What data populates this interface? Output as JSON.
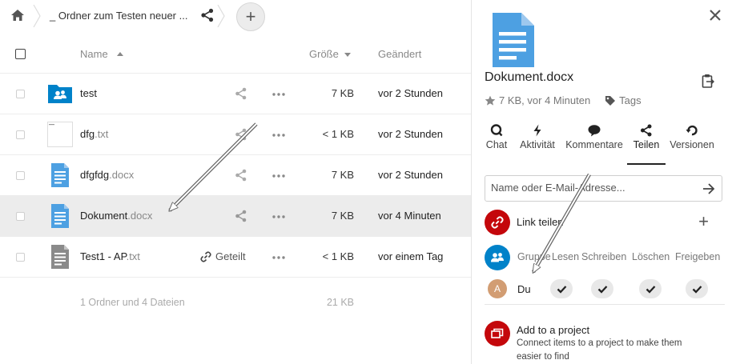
{
  "breadcrumb": {
    "folder": "_ Ordner zum Testen neuer ...",
    "add_label": "+"
  },
  "table": {
    "col_name": "Name",
    "col_size": "Größe",
    "col_modified": "Geändert"
  },
  "files": [
    {
      "name": "test",
      "ext": "",
      "type": "shared-folder",
      "size": "7 KB",
      "modified": "vor 2 Stunden",
      "shared": false
    },
    {
      "name": "dfg",
      "ext": ".txt",
      "type": "text-thumb",
      "size": "< 1 KB",
      "modified": "vor 2 Stunden",
      "shared": false
    },
    {
      "name": "dfgfdg",
      "ext": ".docx",
      "type": "docx",
      "size": "7 KB",
      "modified": "vor 2 Stunden",
      "shared": false
    },
    {
      "name": "Dokument",
      "ext": ".docx",
      "type": "docx",
      "size": "7 KB",
      "modified": "vor 4 Minuten",
      "shared": false
    },
    {
      "name": "Test1 - AP",
      "ext": ".txt",
      "type": "txt",
      "size": "< 1 KB",
      "modified": "vor einem Tag",
      "shared": true,
      "shared_label": "Geteilt"
    }
  ],
  "summary": {
    "count": "1 Ordner und 4 Dateien",
    "total": "21 KB"
  },
  "sidebar": {
    "title": "Dokument.docx",
    "meta_size": "7 KB, vor 4 Minuten",
    "meta_tags": "Tags",
    "tabs": [
      {
        "label": "Chat",
        "icon": "chat-icon"
      },
      {
        "label": "Aktivität",
        "icon": "activity-icon"
      },
      {
        "label": "Kommentare",
        "icon": "comment-icon"
      },
      {
        "label": "Teilen",
        "icon": "share-icon",
        "active": true
      },
      {
        "label": "Versionen",
        "icon": "history-icon"
      }
    ],
    "share_placeholder": "Name oder E-Mail-Adresse...",
    "link_label": "Link teilen",
    "perm_headers": [
      "Gruppe",
      "Lesen",
      "Schreiben",
      "Löschen",
      "Freigeben"
    ],
    "perm_user": {
      "initial": "A",
      "name": "Du"
    },
    "project_title": "Add to a project",
    "project_desc": "Connect items to a project to make them easier to find"
  },
  "colors": {
    "accent_blue": "#0082c9",
    "doc_blue": "#4da0e2",
    "link_red": "#c4070b",
    "text_gray": "#888888",
    "avatar_tan": "#d29d73"
  }
}
